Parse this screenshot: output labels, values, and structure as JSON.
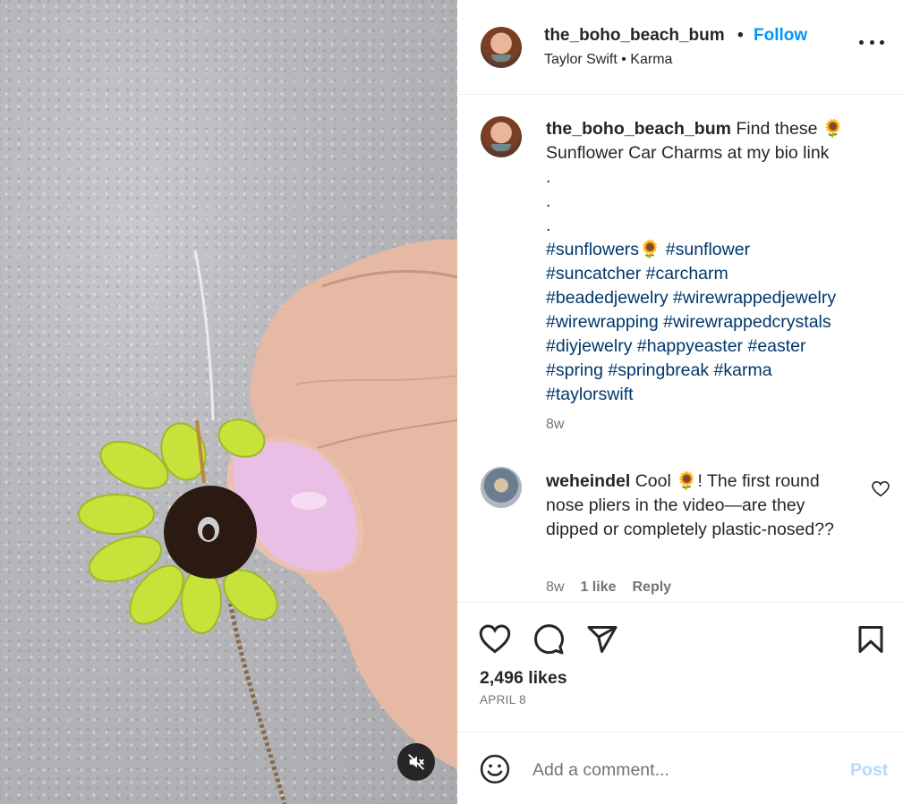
{
  "post": {
    "username": "the_boho_beach_bum",
    "separator": "•",
    "follow_label": "Follow",
    "audio": "Taylor Swift • Karma",
    "caption": {
      "line1_text": "Find these",
      "emoji": "🌻",
      "line2": "Sunflower Car Charms at my bio link",
      "dots": [
        ".",
        ".",
        "."
      ],
      "tags": [
        [
          "#sunflowers🌻",
          "#sunflower"
        ],
        [
          "#suncatcher",
          "#carcharm"
        ],
        [
          "#beadedjewelry",
          "#wirewrappedjewelry"
        ],
        [
          "#wirewrapping",
          "#wirewrappedcrystals"
        ],
        [
          "#diyjewelry",
          "#happyeaster",
          "#easter"
        ],
        [
          "#spring",
          "#springbreak",
          "#karma"
        ],
        [
          "#taylorswift"
        ]
      ],
      "time": "8w"
    },
    "comment": {
      "username": "weheindel",
      "text": "Cool 🌻! The first round nose pliers in the video—are they dipped or completely plastic-nosed??",
      "time": "8w",
      "likes": "1 like",
      "reply_label": "Reply"
    },
    "likes": "2,496 likes",
    "date": "APRIL 8",
    "add_comment_placeholder": "Add a comment...",
    "post_label": "Post"
  },
  "icons": {
    "more": "more-options-icon",
    "like": "heart-icon",
    "comment": "comment-bubble-icon",
    "share": "paper-plane-icon",
    "save": "bookmark-icon",
    "emoji": "emoji-smiley-icon",
    "mute": "speaker-muted-icon"
  },
  "colors": {
    "link_blue": "#0095f6",
    "hashtag": "#00376b",
    "secondary_text": "#737373",
    "post_disabled": "#b3dbff"
  }
}
